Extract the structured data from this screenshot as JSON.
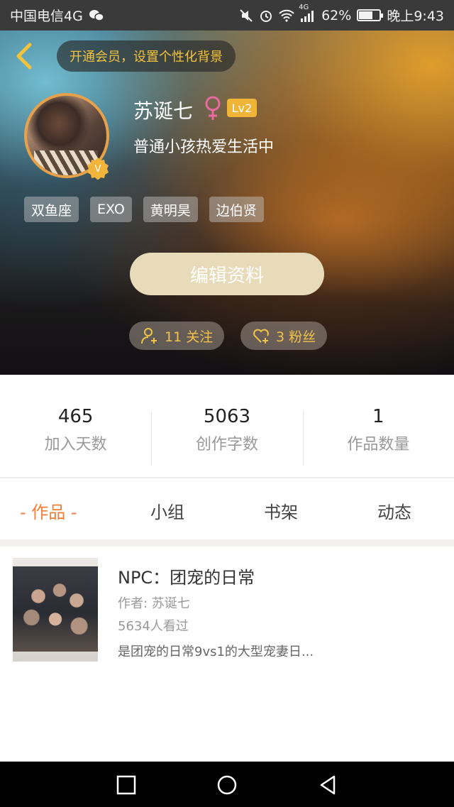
{
  "status_bar": {
    "carrier": "中国电信4G",
    "network_label": "4G",
    "battery_percent": "62%",
    "time": "晚上9:43"
  },
  "header": {
    "vip_banner": "开通会员，设置个性化背景"
  },
  "profile": {
    "username": "苏诞七",
    "level": "Lv2",
    "bio": "普通小孩热爱生活中",
    "tags": [
      "双鱼座",
      "EXO",
      "黄明昊",
      "边伯贤"
    ],
    "edit_button": "编辑资料",
    "following": "11 关注",
    "followers": "3 粉丝"
  },
  "stats": [
    {
      "value": "465",
      "label": "加入天数"
    },
    {
      "value": "5063",
      "label": "创作字数"
    },
    {
      "value": "1",
      "label": "作品数量"
    }
  ],
  "tabs": [
    {
      "label": "- 作品 -",
      "active": true
    },
    {
      "label": "小组",
      "active": false
    },
    {
      "label": "书架",
      "active": false
    },
    {
      "label": "动态",
      "active": false
    }
  ],
  "works": [
    {
      "title": "NPC：团宠的日常",
      "author": "作者: 苏诞七",
      "views": "5634人看过",
      "description": "是团宠的日常9vs1的大型宠妻日..."
    }
  ],
  "colors": {
    "accent": "#f07f3a",
    "gold": "#f1c34a",
    "level_badge": "#f0b437",
    "edit_button_bg": "#e7dbb9"
  },
  "icons": {
    "back": "chevron-left-icon",
    "gender": "female-icon",
    "verified": "v-badge-icon",
    "following": "person-add-icon",
    "followers": "heart-add-icon"
  }
}
